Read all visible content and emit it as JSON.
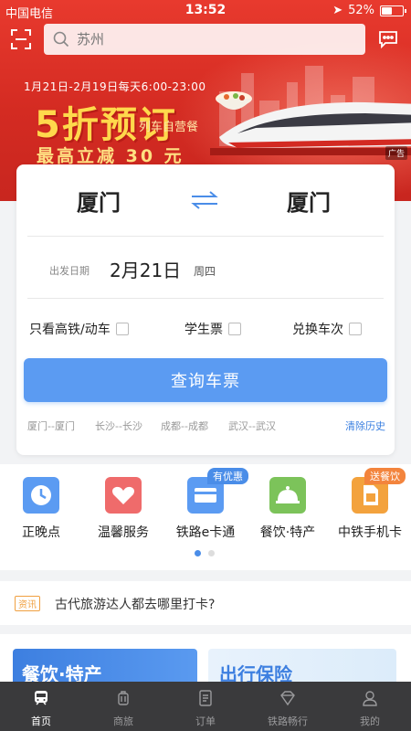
{
  "status_bar": {
    "carrier": "中国电信",
    "time": "13:52",
    "battery": "52%",
    "battery_level": 0.52
  },
  "search": {
    "placeholder": "苏州"
  },
  "banner": {
    "date_line": "1月21日-2月19日每天6:00-23:00",
    "headline": "5折预订",
    "sub": "列车自营餐",
    "bottom": "最高立减 30 元",
    "ad_tag": "广告"
  },
  "booking": {
    "from": "厦门",
    "to": "厦门",
    "date_label": "出发日期",
    "date": "2月21日",
    "weekday": "周四",
    "options": [
      "只看高铁/动车",
      "学生票",
      "兑换车次"
    ],
    "query_button": "查询车票",
    "history": [
      "厦门--厦门",
      "长沙--长沙",
      "成都--成都",
      "武汉--武汉"
    ],
    "clear_history": "清除历史"
  },
  "services": [
    {
      "label": "正晚点",
      "icon": "clock-icon",
      "color": "#5b9bf2",
      "tag": ""
    },
    {
      "label": "温馨服务",
      "icon": "heart-icon",
      "color": "#ef6b6b",
      "tag": ""
    },
    {
      "label": "铁路e卡通",
      "icon": "card-icon",
      "color": "#5b9bf2",
      "tag": "有优惠"
    },
    {
      "label": "餐饮·特产",
      "icon": "dish-icon",
      "color": "#7cc35a",
      "tag": ""
    },
    {
      "label": "中铁手机卡",
      "icon": "sim-icon",
      "color": "#f3a23d",
      "tag": "送餐饮"
    }
  ],
  "news": {
    "tag": "资讯",
    "text": "古代旅游达人都去哪里打卡?"
  },
  "promo_cards": [
    "餐饮·特产",
    "出行保险"
  ],
  "tabbar": [
    {
      "label": "首页",
      "icon": "train-icon",
      "active": true
    },
    {
      "label": "商旅",
      "icon": "luggage-icon",
      "active": false
    },
    {
      "label": "订单",
      "icon": "order-icon",
      "active": false
    },
    {
      "label": "铁路畅行",
      "icon": "diamond-icon",
      "active": false
    },
    {
      "label": "我的",
      "icon": "user-icon",
      "active": false
    }
  ]
}
